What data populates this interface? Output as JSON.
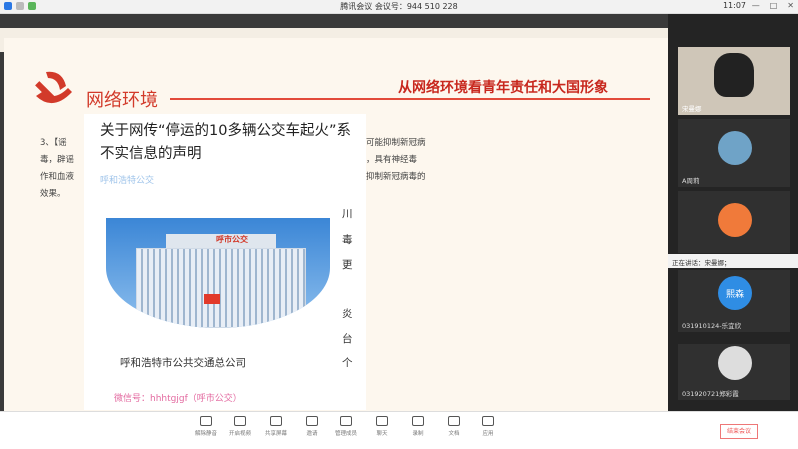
{
  "window": {
    "title": "腾讯会议  会议号：944 510 228",
    "time": "11:07",
    "controls": [
      "—",
      "□",
      "✕"
    ]
  },
  "slide": {
    "section_title": "网络环境",
    "heading": "从网络环境看青年责任和大国形象",
    "text_lines": [
      "3、【谣",
      "毒，辟谣",
      "作和血液",
      "效果。"
    ],
    "right_text_lines": [
      "可能抑制新冠病",
      "，具有神经毒",
      "抑制新冠病毒的"
    ]
  },
  "article": {
    "title": "关于网传“停运的10多辆公交车起火”系不实信息的声明",
    "source": "呼和浩特公交",
    "photo_sign": "呼市公交",
    "company": "呼和浩特市公共交通总公司",
    "wechat": "微信号：hhhtgjgf（呼市公交）",
    "side_chars": [
      "川",
      "毒",
      "更",
      "炎",
      "台",
      "个"
    ]
  },
  "participants": [
    {
      "name": "宋曼娜",
      "type": "video"
    },
    {
      "name": "A周莉",
      "type": "photo"
    },
    {
      "name": "",
      "type": "cartoon"
    },
    {
      "name": "031910124-乐宜欣",
      "type": "avatar",
      "avatar_text": "熙森"
    },
    {
      "name": "031920721郑彩霞",
      "type": "panda"
    }
  ],
  "speaking": "正在讲话：宋曼娜；",
  "toolbar": {
    "items": [
      "解除静音",
      "开启视频",
      "共享屏幕",
      "邀请",
      "管理成员",
      "聊天",
      "录制",
      "文档",
      "应用"
    ],
    "end_label": "结束会议"
  },
  "colors": {
    "accent_red": "#d23a2a",
    "source_blue": "#9fc4ea",
    "wechat_pink": "#e36aa0"
  }
}
